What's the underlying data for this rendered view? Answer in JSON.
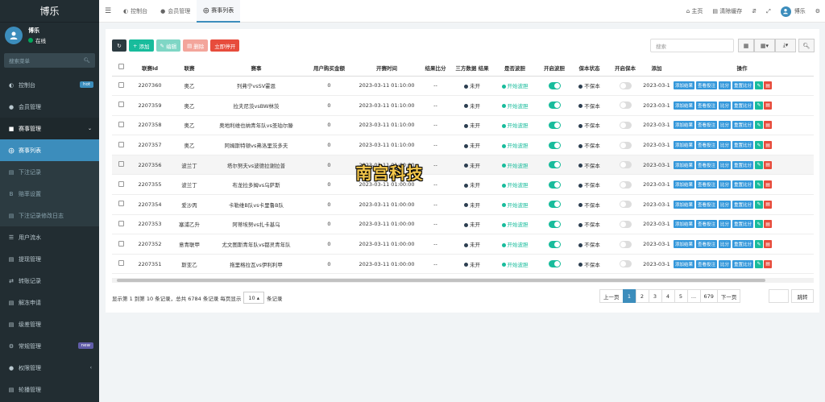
{
  "app": {
    "logo_text": "博乐"
  },
  "user": {
    "name": "博乐",
    "status": "在线"
  },
  "sidebar": {
    "search_placeholder": "搜索菜单",
    "items": [
      {
        "label": "控制台",
        "icon": "dashboard-icon",
        "badge": "hot"
      },
      {
        "label": "会员管理",
        "icon": "users-icon"
      },
      {
        "label": "赛事管理",
        "icon": "trophy-icon"
      },
      {
        "label": "赛事列表",
        "icon": "list-icon"
      },
      {
        "label": "下注记录",
        "icon": "record-icon"
      },
      {
        "label": "赔率设置",
        "icon": "odds-icon"
      },
      {
        "label": "下注记录修改日志",
        "icon": "log-icon"
      },
      {
        "label": "用户流水",
        "icon": "flow-icon"
      },
      {
        "label": "提现管理",
        "icon": "withdraw-icon"
      },
      {
        "label": "转账记录",
        "icon": "transfer-icon"
      },
      {
        "label": "解冻申请",
        "icon": "unfreeze-icon"
      },
      {
        "label": "级差管理",
        "icon": "level-icon"
      },
      {
        "label": "常规管理",
        "icon": "cog-icon",
        "badge": "new"
      },
      {
        "label": "权限管理",
        "icon": "lock-icon"
      },
      {
        "label": "轮播管理",
        "icon": "carousel-icon"
      }
    ]
  },
  "topbar": {
    "tabs": [
      {
        "label": "控制台"
      },
      {
        "label": "会员管理"
      },
      {
        "label": "赛事列表"
      }
    ],
    "home": "主页",
    "clear_cache": "清除缓存",
    "username": "博乐"
  },
  "toolbar": {
    "add": "添加",
    "edit": "编辑",
    "delete": "删除",
    "lottery": "立即停开",
    "search_placeholder": "搜索"
  },
  "table": {
    "headers": [
      "联赛Id",
      "联赛",
      "赛事",
      "用户购买金额",
      "开赛时间",
      "结果比分",
      "三方数据 结果",
      "是否波胆",
      "开启波胆",
      "保本状态",
      "开启保本",
      "添加",
      "操作"
    ],
    "op_labels": [
      "添加结果",
      "查看投注",
      "比分",
      "重置比分"
    ],
    "rows": [
      {
        "id": "2207360",
        "league": "奥乙",
        "match": "列弗宁vsSV霍恩",
        "amount": "0",
        "time": "2023-03-11 01:10:00",
        "score": "--",
        "third": "未开",
        "bodan": "开始波胆",
        "baoben": "不保本",
        "added": "2023-03-1"
      },
      {
        "id": "2207359",
        "league": "奥乙",
        "match": "拉夫尼茨vsBW林茨",
        "amount": "0",
        "time": "2023-03-11 01:10:00",
        "score": "--",
        "third": "未开",
        "bodan": "开始波胆",
        "baoben": "不保本",
        "added": "2023-03-1"
      },
      {
        "id": "2207358",
        "league": "奥乙",
        "match": "奥地利维也纳青年队vs圣珀尔滕",
        "amount": "0",
        "time": "2023-03-11 01:10:00",
        "score": "--",
        "third": "未开",
        "bodan": "开始波胆",
        "baoben": "不保本",
        "added": "2023-03-1"
      },
      {
        "id": "2207357",
        "league": "奥乙",
        "match": "阿姆斯特顿vs弗洛里茨多夫",
        "amount": "0",
        "time": "2023-03-11 01:10:00",
        "score": "--",
        "third": "未开",
        "bodan": "开始波胆",
        "baoben": "不保本",
        "added": "2023-03-1"
      },
      {
        "id": "2207356",
        "league": "波兰丁",
        "match": "塔尔努夫vs波德拉谢拉普",
        "amount": "0",
        "time": "2023-03-11 01:00:00",
        "score": "--",
        "third": "未开",
        "bodan": "开始波胆",
        "baoben": "不保本",
        "added": "2023-03-1"
      },
      {
        "id": "2207355",
        "league": "波兰丁",
        "match": "布龙拉多姆vs乌萨斯",
        "amount": "0",
        "time": "2023-03-11 01:00:00",
        "score": "--",
        "third": "未开",
        "bodan": "开始波胆",
        "baoben": "不保本",
        "added": "2023-03-1"
      },
      {
        "id": "2207354",
        "league": "爱沙丙",
        "match": "卡勒维B队vs卡里鲁B队",
        "amount": "0",
        "time": "2023-03-11 01:00:00",
        "score": "--",
        "third": "未开",
        "bodan": "开始波胆",
        "baoben": "不保本",
        "added": "2023-03-1"
      },
      {
        "id": "2207353",
        "league": "塞浦乙升",
        "match": "阿蒂埃努vs扎卡基乌",
        "amount": "0",
        "time": "2023-03-11 01:00:00",
        "score": "--",
        "third": "未开",
        "bodan": "开始波胆",
        "baoben": "不保本",
        "added": "2023-03-1"
      },
      {
        "id": "2207352",
        "league": "意青联甲",
        "match": "尤文图斯青年队vs都灵青年队",
        "amount": "0",
        "time": "2023-03-11 01:00:00",
        "score": "--",
        "third": "未开",
        "bodan": "开始波胆",
        "baoben": "不保本",
        "added": "2023-03-1"
      },
      {
        "id": "2207351",
        "league": "斯亚乙",
        "match": "拖里格拉瓦vs伊利利甲",
        "amount": "0",
        "time": "2023-03-11 01:00:00",
        "score": "--",
        "third": "未开",
        "bodan": "开始波胆",
        "baoben": "不保本",
        "added": "2023-03-1"
      }
    ]
  },
  "pager": {
    "info_prefix": "显示第 1 到第 10 条记录，总共 6784 条记录 每页显示",
    "page_size": "10",
    "info_suffix": "条记录",
    "prev": "上一页",
    "pages": [
      "1",
      "2",
      "3",
      "4",
      "5",
      "...",
      "679"
    ],
    "next": "下一页",
    "jump": "跳转"
  },
  "watermark": {
    "text": "南宫科技"
  },
  "colors": {
    "sidebar_bg": "#222d32",
    "primary": "#3c8dbc",
    "success": "#18bc9c",
    "danger": "#e74c3c",
    "info_btn": "#3498db"
  }
}
